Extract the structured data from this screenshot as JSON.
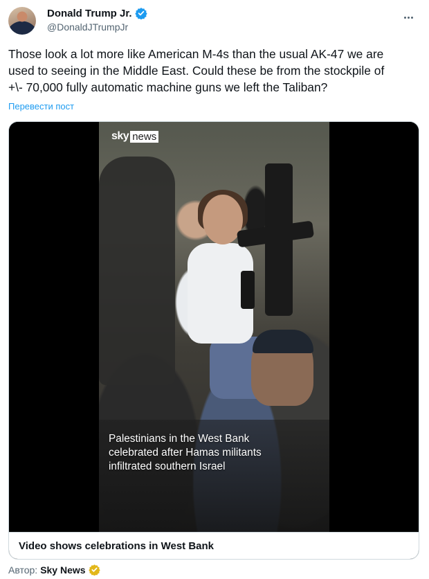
{
  "author": {
    "display_name": "Donald Trump Jr.",
    "handle": "@DonaldJTrumpJr",
    "verified_icon": "blue-verified-badge-icon",
    "avatar_icon": "profile-avatar"
  },
  "tweet": {
    "lines": [
      "Those look a lot more like American M-4s than the usual AK-47 we are",
      "used to seeing in the Middle East. Could these be from the stockpile of",
      "+\\- 70,000 fully automatic machine guns we left the Taliban?"
    ],
    "translate_label": "Перевести пост"
  },
  "media": {
    "logo_sky": "sky",
    "logo_news": "news",
    "caption_lines": [
      "Palestinians in the West Bank",
      "celebrated after Hamas militants",
      "infiltrated southern Israel"
    ],
    "card_title": "Video shows celebrations in West Bank"
  },
  "attribution": {
    "prefix": "Автор:",
    "name": "Sky News",
    "badge_icon": "gold-verified-badge-icon"
  },
  "colors": {
    "accent_blue": "#1d9bf0",
    "gold_badge": "#e2b719",
    "text_primary": "#0f1419",
    "text_secondary": "#536471",
    "border": "#cfd9de"
  }
}
